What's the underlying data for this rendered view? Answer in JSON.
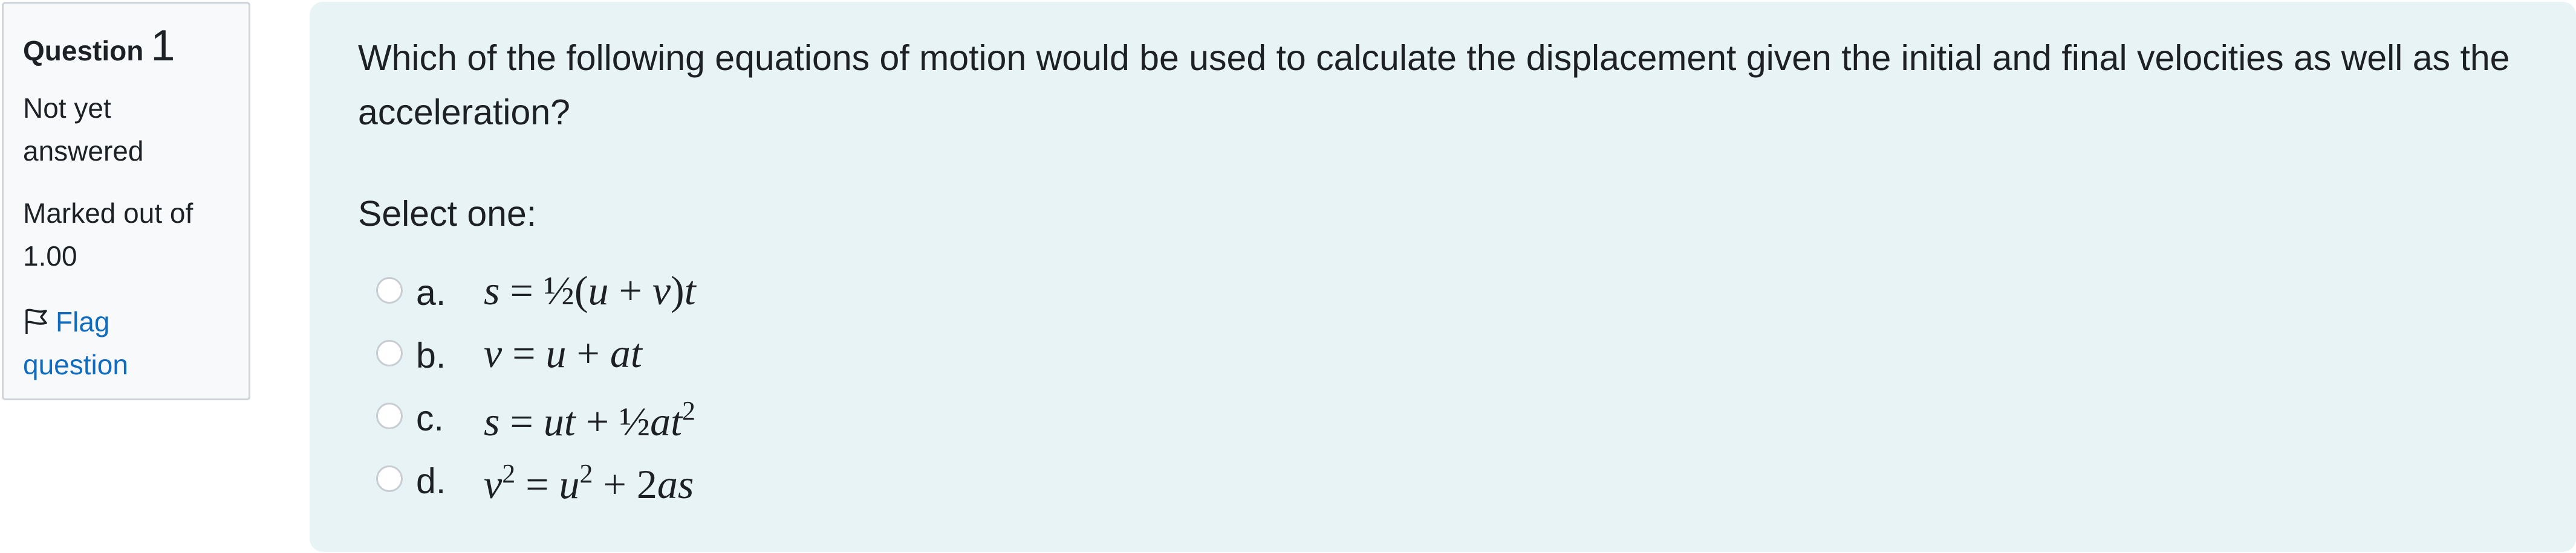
{
  "info": {
    "question_label": "Question",
    "question_number": "1",
    "state": "Not yet answered",
    "grade": "Marked out of 1.00",
    "flag_label": "Flag question",
    "flag_icon": "flag-outline-icon"
  },
  "question": {
    "text": "Which of the following equations of motion would be used to calculate the displacement given the initial and final velocities as well as the acceleration?",
    "prompt": "Select one:",
    "answers": [
      {
        "letter": "a.",
        "lhs": "s",
        "rhs_parts": [
          "½(",
          "u",
          " + ",
          "v",
          ")",
          "t"
        ]
      },
      {
        "letter": "b.",
        "lhs": "v",
        "rhs_parts": [
          "u",
          " + ",
          "at"
        ]
      },
      {
        "letter": "c.",
        "lhs": "s",
        "rhs_parts": [
          "ut",
          " + ",
          "½",
          "at",
          "2"
        ]
      },
      {
        "letter": "d.",
        "lhs": "v",
        "lhs_sup": "2",
        "rhs_parts": [
          "u",
          "2",
          " + ",
          "2",
          "as"
        ]
      }
    ],
    "equals": " = "
  },
  "colors": {
    "content_bg": "#e7f3f5",
    "info_bg": "#f8f9fa",
    "link": "#0f6cbf",
    "text": "#1d2125"
  }
}
